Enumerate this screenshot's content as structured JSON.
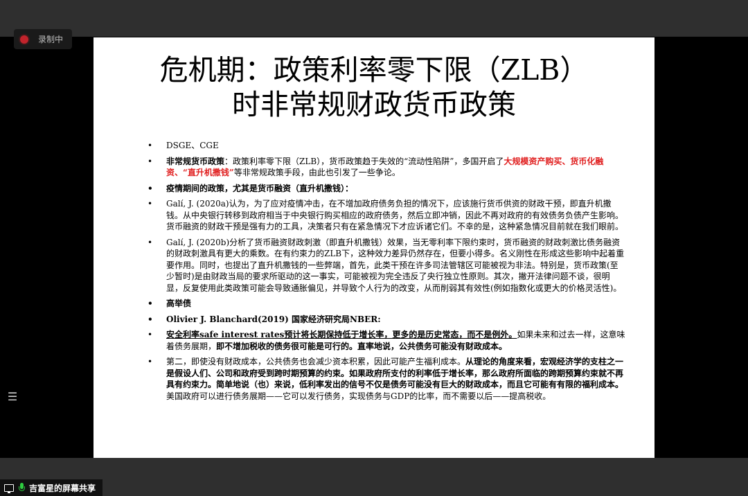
{
  "recording": {
    "label": "录制中"
  },
  "share": {
    "label": "吉富星的屏幕共享"
  },
  "slide": {
    "title_line1": "危机期：政策利率零下限（ZLB）",
    "title_line2": "时非常规财政货币政策",
    "bullet": "•",
    "p1": "DSGE、CGE",
    "p2_bold": "非常规货币政策",
    "p2_text": "：政策利率零下限（ZLB），货币政策趋于失效的“流动性陷阱”，多国开启了",
    "p2_red": "大规模资产购买、货币化融资、“直升机撒钱”",
    "p2_tail": "等非常规政策手段，由此也引发了一些争论。",
    "p3": "疫情期间的政策，尤其是货币融资（直升机撒钱）：",
    "p4": "Galí, J. (2020a)认为，为了应对疫情冲击，在不增加政府债务负担的情况下，应该施行货币供资的财政干预，即直升机撒钱。从中央银行转移到政府相当于中央银行购买相应的政府债务，然后立即冲销，因此不再对政府的有效债务负债产生影响。货币融资的财政干预是强有力的工具，决策者只有在紧急情况下才应诉诸它们。不幸的是，这种紧急情况目前就在我们眼前。",
    "p5": "Galí, J. (2020b)分析了货币融资财政刺激（即直升机撒钱）效果，当无零利率下限约束时，货币融资的财政刺激比债务融资的财政刺激具有更大的乘数。在有约束力的ZLB下，这种效力差异仍然存在，但要小得多。名义刚性在形成这些影响中起着重要作用。同时，也提出了直升机撒钱的一些弊端，首先，此类干预在许多司法管辖区可能被视为非法。特别是，货币政策(至少暂时)是由财政当局的要求所驱动的这一事实，可能被视为完全违反了央行独立性原则。其次，撇开法律问题不谈，很明显，反复使用此类政策可能会导致通胀偏见，并导致个人行为的改变，从而削弱其有效性(例如指数化或更大的价格灵活性)。",
    "p6": "高举债",
    "p7": "Olivier J. Blanchard(2019) 国家经济研究局NBER:",
    "p8_u": "安全利率safe interest rates预计将长期保持低于增长率，更多的是历史常态，而不是例外。",
    "p8_text": "如果未来和过去一样，这意味着债务展期，",
    "p8_bold": "即不增加税收的债务很可能是可行的。直率地说，公共债务可能没有财政成本。",
    "p9_text1": "第二，即使没有财政成本，公共债务也会减少资本积累，因此可能产生福利成本。",
    "p9_bold": "从理论的角度来看，宏观经济学的支柱之一是假设人们、公司和政府受到跨时期预算的约束。如果政府所支付的利率低于增长率，那么政府所面临的跨期预算约束就不再具有约束力。简单地说（也）来说，低利率发出的信号不仅是债务可能没有巨大的财政成本，而且它可能有有限的福利成本。",
    "p9_text2": "美国政府可以进行债务展期——它可以发行债务，实现债务与GDP的比率，而不需要以后——提高税收。"
  }
}
